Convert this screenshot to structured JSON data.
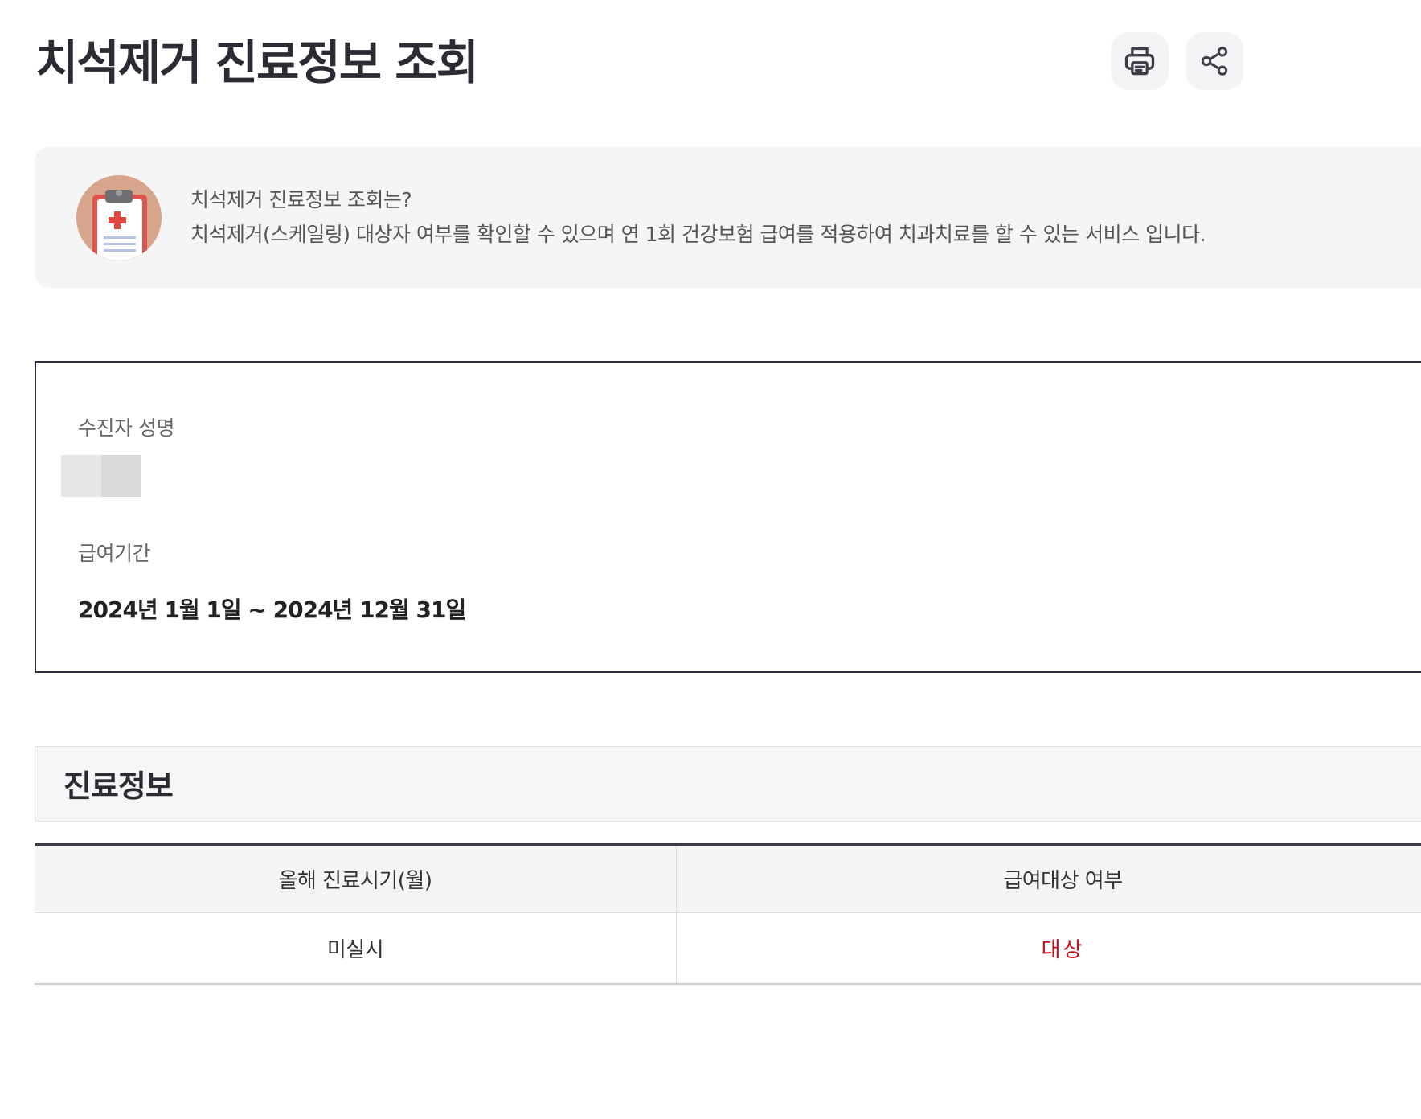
{
  "page": {
    "title": "치석제거 진료정보 조회"
  },
  "toolbar": {
    "print_icon": "printer-icon",
    "share_icon": "share-icon"
  },
  "intro": {
    "icon": "clipboard-medical-icon",
    "title": "치석제거 진료정보 조회는?",
    "description": "치석제거(스케일링) 대상자 여부를 확인할 수 있으며 연 1회 건강보험 급여를 적용하여 치과치료를 할 수 있는 서비스 입니다."
  },
  "info": {
    "name_label": "수진자 성명",
    "period_label": "급여기간",
    "period_value": "2024년 1월 1일 ~ 2024년 12월 31일"
  },
  "treatment": {
    "section_title": "진료정보",
    "columns": [
      "올해 진료시기(월)",
      "급여대상 여부"
    ],
    "rows": [
      [
        "미실시",
        "대상"
      ]
    ]
  },
  "colors": {
    "accent_dark": "#2d2f40",
    "status_red": "#c40f1a",
    "panel_gray": "#f5f5f5"
  }
}
